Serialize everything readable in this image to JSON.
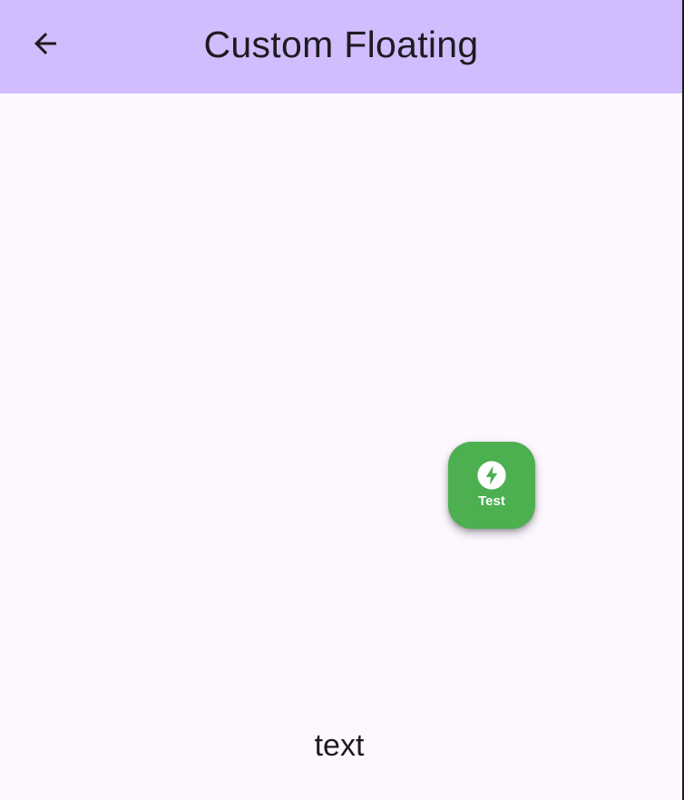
{
  "app_bar": {
    "title": "Custom Floating",
    "back_icon": "arrow-back-icon",
    "background_color": "#d1bcfd"
  },
  "fab": {
    "label": "Test",
    "icon": "bolt-circle-icon",
    "background_color": "#4caf50"
  },
  "body": {
    "text": "text",
    "background_color": "#fdf7ff"
  }
}
